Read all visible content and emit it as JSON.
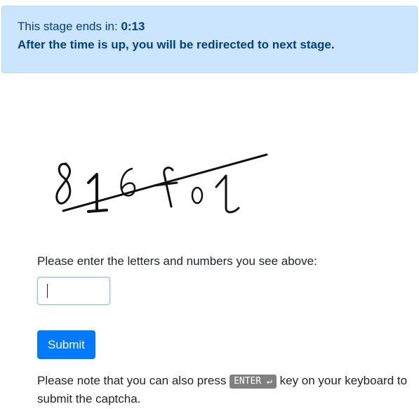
{
  "timer": {
    "prefix": "This stage ends in:",
    "value": "0:13",
    "message": "After the time is up, you will be redirected to next stage."
  },
  "captcha": {
    "image_text": "816f01"
  },
  "form": {
    "prompt": "Please enter the letters and numbers you see above:",
    "input_value": "",
    "submit_label": "Submit"
  },
  "note": {
    "before": "Please note that you can also press",
    "key_label": "ENTER ↵",
    "after": "key on your keyboard to submit the captcha."
  },
  "colors": {
    "info_bg": "#cce5ff",
    "info_text": "#004085",
    "primary": "#007bff",
    "key_bg": "#808080"
  }
}
